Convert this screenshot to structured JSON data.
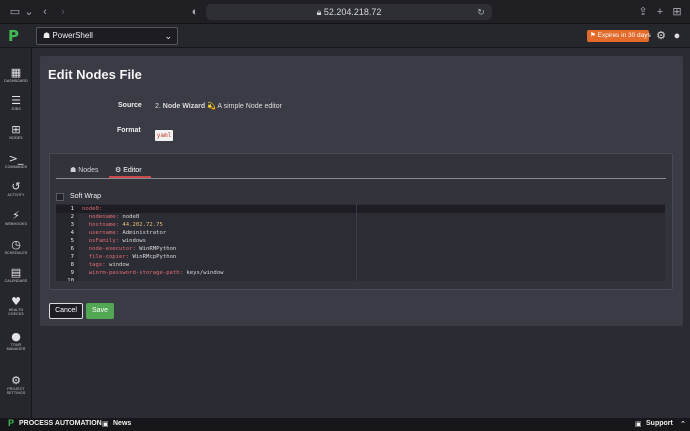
{
  "browser": {
    "url": "52.204.218.72"
  },
  "header": {
    "logo": "P",
    "project": "PowerShell",
    "expires": "⚑ Expires in 30 days"
  },
  "sidebar": {
    "items": [
      {
        "icon": "dashboard-icon",
        "glyph": "▦",
        "label": "DASHBOARD"
      },
      {
        "icon": "jobs-icon",
        "glyph": "☰",
        "label": "JOBS"
      },
      {
        "icon": "nodes-icon",
        "glyph": "⊞",
        "label": "NODES"
      },
      {
        "icon": "commands-icon",
        "glyph": ">_",
        "label": "COMMANDS"
      },
      {
        "icon": "activity-icon",
        "glyph": "↺",
        "label": "ACTIVITY"
      },
      {
        "icon": "webhooks-icon",
        "glyph": "⚡",
        "label": "WEBHOOKS"
      },
      {
        "icon": "schedules-icon",
        "glyph": "◷",
        "label": "SCHEDULES"
      },
      {
        "icon": "calendars-icon",
        "glyph": "▤",
        "label": "CALENDARS"
      },
      {
        "icon": "health-checks-icon",
        "glyph": "♥",
        "label": "HEALTH CHECKS"
      },
      {
        "icon": "tour-manager-icon",
        "glyph": "●",
        "label": "TOUR MANAGER"
      },
      {
        "icon": "project-settings-icon",
        "glyph": "⚙",
        "label": "PROJECT SETTINGS"
      }
    ]
  },
  "page": {
    "title": "Edit Nodes File",
    "source_label": "Source",
    "source_prefix": "2.",
    "source_name": "Node Wizard",
    "source_emoji": "💫",
    "source_desc": "A simple Node editor",
    "format_label": "Format",
    "format_value": "yaml",
    "tabs": [
      {
        "label": "Nodes",
        "icon": "nodes-tab-icon"
      },
      {
        "label": "Editor",
        "icon": "gear-icon"
      }
    ],
    "soft_wrap_label": "Soft Wrap",
    "cancel_label": "Cancel",
    "save_label": "Save"
  },
  "editor": {
    "lines": [
      {
        "num": "1",
        "key": "node0:",
        "val": ""
      },
      {
        "num": "2",
        "key": "  nodename:",
        "val": " node0"
      },
      {
        "num": "3",
        "key": "  hostname:",
        "val": " 44.202.72.75"
      },
      {
        "num": "4",
        "key": "  username:",
        "val": " Administrator"
      },
      {
        "num": "5",
        "key": "  osFamily:",
        "val": " windows"
      },
      {
        "num": "6",
        "key": "  node-executor:",
        "val": " WinRMPython"
      },
      {
        "num": "7",
        "key": "  file-copier:",
        "val": " WinRMcpPython"
      },
      {
        "num": "8",
        "key": "  tags:",
        "val": " window"
      },
      {
        "num": "9",
        "key": "  winrm-password-storage-path:",
        "val": " keys/window"
      },
      {
        "num": "10",
        "key": "",
        "val": ""
      }
    ]
  },
  "footer": {
    "brand": "PROCESS AUTOMATION",
    "news": "News",
    "support": "Support"
  },
  "colors": {
    "accent_green": "#3fb950",
    "expires_orange": "#e36a2a",
    "tab_underline": "#c84a4a",
    "save_green": "#52a852"
  }
}
